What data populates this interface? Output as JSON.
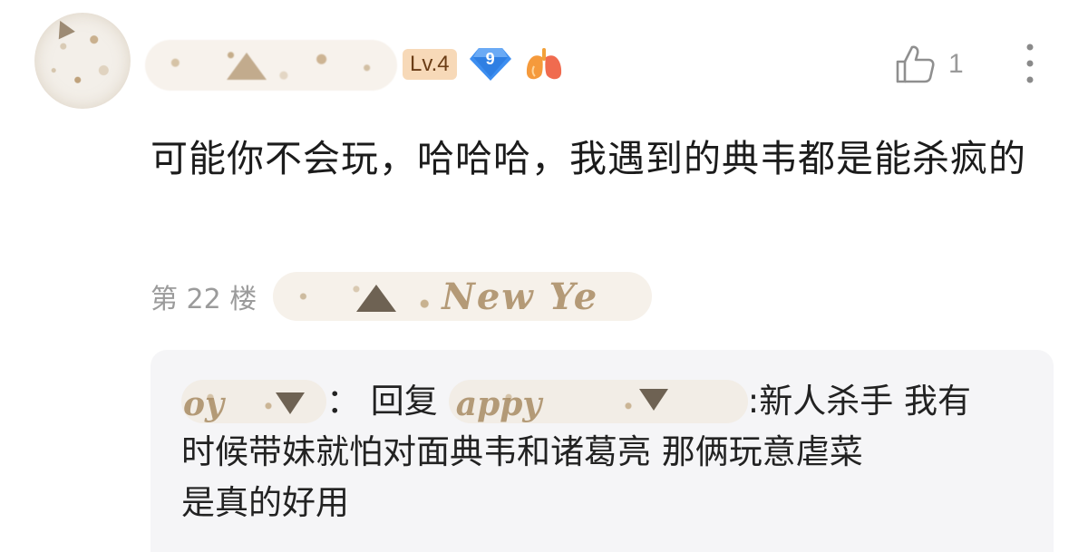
{
  "comment": {
    "user": {
      "level_badge": "Lv.4",
      "gem_level": "9"
    },
    "like_count": "1",
    "text": "可能你不会玩，哈哈哈，我遇到的典韦都是能杀疯的",
    "floor_label": "第 22 楼",
    "floor_decoration_text": "New Ye"
  },
  "reply": {
    "replier_name_partial": "oy",
    "reply_prefix": "：  回复",
    "target_name_partial": "appy",
    "text_line1": ":新人杀手 我有",
    "text_line2": "时候带妹就怕对面典韦和诸葛亮 那俩玩意虐菜",
    "text_line3": "是真的好用"
  },
  "colors": {
    "level_badge_bg": "#f7d9b8",
    "gem_blue": "#3d8ef0",
    "reply_bg": "#f5f5f7",
    "muted_text": "#9b9b9b"
  },
  "icons": {
    "like": "thumbs-up-icon",
    "more": "more-vertical-icon",
    "gem": "diamond-icon",
    "lung": "lung-icon"
  }
}
